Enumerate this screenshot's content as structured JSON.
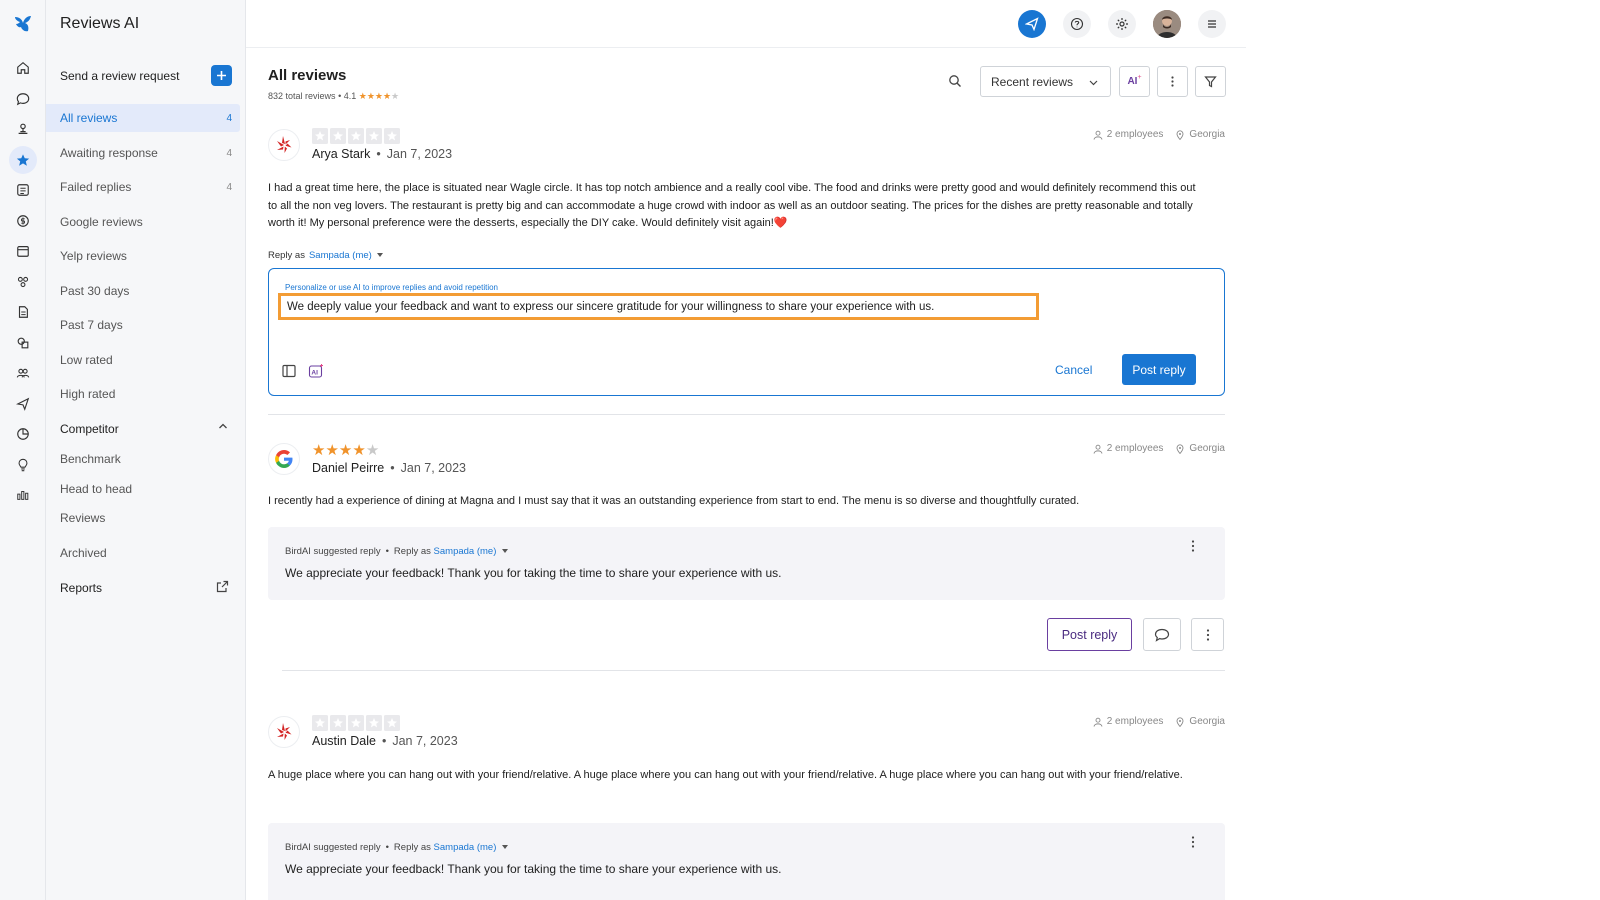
{
  "app": {
    "title": "Reviews AI"
  },
  "sidebar": {
    "send_request": "Send a review request",
    "items": [
      {
        "label": "All reviews",
        "count": "4"
      },
      {
        "label": "Awaiting response",
        "count": "4"
      },
      {
        "label": "Failed replies",
        "count": "4"
      },
      {
        "label": "Google reviews",
        "count": ""
      },
      {
        "label": "Yelp reviews",
        "count": ""
      },
      {
        "label": "Past 30 days",
        "count": ""
      },
      {
        "label": "Past 7 days",
        "count": ""
      },
      {
        "label": "Low rated",
        "count": ""
      },
      {
        "label": "High rated",
        "count": ""
      }
    ],
    "competitor": {
      "label": "Competitor",
      "items": [
        "Benchmark",
        "Head to head",
        "Reviews"
      ]
    },
    "archived": "Archived",
    "reports": "Reports"
  },
  "header": {
    "title": "All reviews",
    "total": "832 total reviews",
    "bullet": "•",
    "rating": "4.1",
    "rating_stars": 4,
    "sort_label": "Recent reviews",
    "ai_label": "AI"
  },
  "reviews": [
    {
      "source": "yelp",
      "name": "Arya Stark",
      "date": "Jan 7, 2023",
      "stars": 0,
      "employees": "2 employees",
      "location": "Georgia",
      "text": "I had a great time here, the place is situated near Wagle circle. It has top notch ambience and a really cool vibe. The food and drinks were pretty good and would definitely recommend this out to all the non veg lovers. The restaurant is pretty big and can accommodate a huge crowd with indoor as well as an outdoor seating. The prices for the dishes are pretty reasonable and totally worth it! My personal preference were the desserts, especially the DIY cake. Would definitely visit again!",
      "heart": "❤️",
      "reply_as_label": "Reply as",
      "reply_as_user": "Sampada (me)",
      "reply_hint": "Personalize or use AI to improve replies and avoid repetition",
      "reply_value": "We deeply value your feedback and want to express our sincere gratitude for your willingness to share your experience with us.",
      "cancel_label": "Cancel",
      "post_label": "Post reply"
    },
    {
      "source": "google",
      "name": "Daniel Peirre",
      "date": "Jan 7, 2023",
      "stars": 4,
      "employees": "2 employees",
      "location": "Georgia",
      "text": "I recently had a experience of dining at Magna and I must say that it was an outstanding experience from start to end. The menu is so diverse and thoughtfully curated.",
      "ai_label": "BirdAI suggested reply",
      "reply_as_label": "Reply as",
      "reply_as_user": "Sampada (me)",
      "ai_reply": "We appreciate your feedback! Thank you for taking the time to share your experience with us.",
      "post_label": "Post reply"
    },
    {
      "source": "yelp",
      "name": "Austin Dale",
      "date": "Jan 7, 2023",
      "stars": 0,
      "employees": "2 employees",
      "location": "Georgia",
      "text": "A huge place where you can hang out with your friend/relative. A huge place where you can hang out with your friend/relative. A huge place where you can hang out with your friend/relative.",
      "ai_label": "BirdAI suggested reply",
      "reply_as_label": "Reply as",
      "reply_as_user": "Sampada (me)",
      "ai_reply": "We appreciate your feedback! Thank you for taking the time to share your experience with us."
    }
  ],
  "colors": {
    "accent": "#1976d2",
    "star": "#f0932b",
    "highlight": "#f39c34",
    "yelp": "#d32323"
  }
}
